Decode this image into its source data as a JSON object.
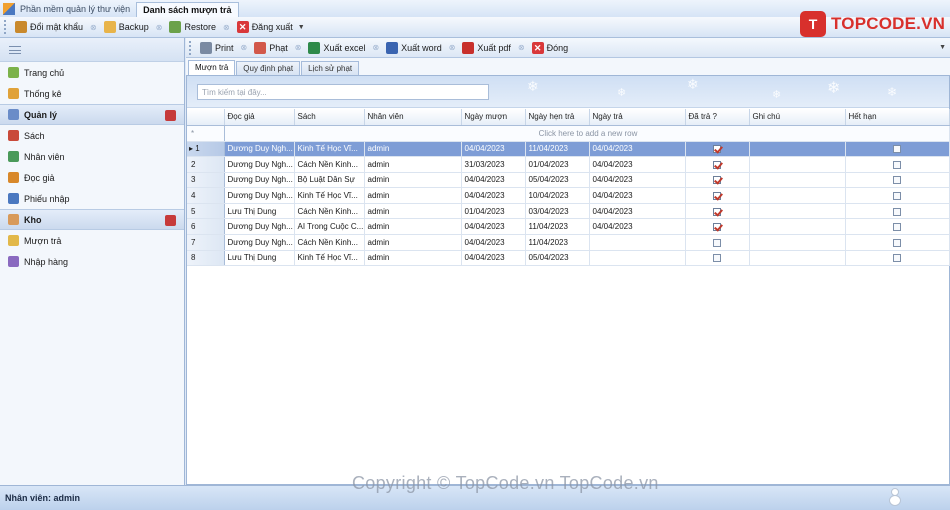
{
  "titlebar": {
    "tabs": [
      {
        "label": "Phần mềm quản lý thư viện",
        "active": false
      },
      {
        "label": "Danh sách mượn trả",
        "active": true
      }
    ]
  },
  "toolbar": {
    "change_password": "Đổi mật khẩu",
    "backup": "Backup",
    "restore": "Restore",
    "logout": "Đăng xuất"
  },
  "brand": {
    "mark": "T",
    "name": "TOPCODE.VN",
    "color": "#d8302c"
  },
  "sidebar": {
    "items": [
      {
        "label": "Trang chủ",
        "icon": "home-icon",
        "type": "item"
      },
      {
        "label": "Thống kê",
        "icon": "statistics-icon",
        "type": "item"
      },
      {
        "label": "Quản lý",
        "icon": "manage-icon",
        "type": "group"
      },
      {
        "label": "Sách",
        "icon": "book-icon",
        "type": "item"
      },
      {
        "label": "Nhân viên",
        "icon": "staff-icon",
        "type": "item"
      },
      {
        "label": "Đọc giả",
        "icon": "reader-icon",
        "type": "item"
      },
      {
        "label": "Phiếu nhập",
        "icon": "receipt-icon",
        "type": "item"
      },
      {
        "label": "Kho",
        "icon": "warehouse-icon",
        "type": "group"
      },
      {
        "label": "Mượn trả",
        "icon": "borrow-icon",
        "type": "item"
      },
      {
        "label": "Nhập hàng",
        "icon": "import-icon",
        "type": "item"
      }
    ]
  },
  "content_toolbar": {
    "print": "Print",
    "fine": "Phạt",
    "export_excel": "Xuất excel",
    "export_word": "Xuất word",
    "export_pdf": "Xuất pdf",
    "close": "Đóng"
  },
  "subtabs": [
    {
      "label": "Mượn trả",
      "active": true
    },
    {
      "label": "Quy định phạt",
      "active": false
    },
    {
      "label": "Lịch sử phạt",
      "active": false
    }
  ],
  "search": {
    "placeholder": "Tìm kiếm tại đây...",
    "value": ""
  },
  "grid": {
    "columns": [
      "Đọc giả",
      "Sách",
      "Nhân viên",
      "Ngày mượn",
      "Ngày hẹn trả",
      "Ngày trả",
      "Đã trả ?",
      "Ghi chú",
      "Hết hạn"
    ],
    "new_row_text": "Click here to add a new row",
    "rows": [
      {
        "id": "1",
        "doc_gia": "Dương Duy Ngh...",
        "sach": "Kinh Tế Học Vĩ...",
        "nhan_vien": "admin",
        "ngay_muon": "04/04/2023",
        "ngay_hen_tra": "11/04/2023",
        "ngay_tra": "04/04/2023",
        "da_tra": true,
        "ghi_chu": "",
        "het_han": false,
        "selected": true
      },
      {
        "id": "2",
        "doc_gia": "Dương Duy Ngh...",
        "sach": "Cách Nền Kinh...",
        "nhan_vien": "admin",
        "ngay_muon": "31/03/2023",
        "ngay_hen_tra": "01/04/2023",
        "ngay_tra": "04/04/2023",
        "da_tra": true,
        "ghi_chu": "",
        "het_han": false,
        "selected": false
      },
      {
        "id": "3",
        "doc_gia": "Dương Duy Ngh...",
        "sach": "Bộ Luật Dân Sự",
        "nhan_vien": "admin",
        "ngay_muon": "04/04/2023",
        "ngay_hen_tra": "05/04/2023",
        "ngay_tra": "04/04/2023",
        "da_tra": true,
        "ghi_chu": "",
        "het_han": false,
        "selected": false
      },
      {
        "id": "4",
        "doc_gia": "Dương Duy Ngh...",
        "sach": "Kinh Tế Học Vĩ...",
        "nhan_vien": "admin",
        "ngay_muon": "04/04/2023",
        "ngay_hen_tra": "10/04/2023",
        "ngay_tra": "04/04/2023",
        "da_tra": true,
        "ghi_chu": "",
        "het_han": false,
        "selected": false
      },
      {
        "id": "5",
        "doc_gia": "Lưu Thị Dung",
        "sach": "Cách Nền Kinh...",
        "nhan_vien": "admin",
        "ngay_muon": "01/04/2023",
        "ngay_hen_tra": "03/04/2023",
        "ngay_tra": "04/04/2023",
        "da_tra": true,
        "ghi_chu": "",
        "het_han": false,
        "selected": false
      },
      {
        "id": "6",
        "doc_gia": "Dương Duy Ngh...",
        "sach": "AI Trong Cuộc C...",
        "nhan_vien": "admin",
        "ngay_muon": "04/04/2023",
        "ngay_hen_tra": "11/04/2023",
        "ngay_tra": "04/04/2023",
        "da_tra": true,
        "ghi_chu": "",
        "het_han": false,
        "selected": false
      },
      {
        "id": "7",
        "doc_gia": "Dương Duy Ngh...",
        "sach": "Cách Nền Kinh...",
        "nhan_vien": "admin",
        "ngay_muon": "04/04/2023",
        "ngay_hen_tra": "11/04/2023",
        "ngay_tra": "",
        "da_tra": false,
        "ghi_chu": "",
        "het_han": false,
        "selected": false
      },
      {
        "id": "8",
        "doc_gia": "Lưu Thị Dung",
        "sach": "Kinh Tế Học Vĩ...",
        "nhan_vien": "admin",
        "ngay_muon": "04/04/2023",
        "ngay_hen_tra": "05/04/2023",
        "ngay_tra": "",
        "da_tra": false,
        "ghi_chu": "",
        "het_han": false,
        "selected": false
      }
    ]
  },
  "statusbar": {
    "text": "Nhân viên: admin"
  },
  "watermark": {
    "text": "Copyright © TopCode.vn   TopCode.vn"
  }
}
